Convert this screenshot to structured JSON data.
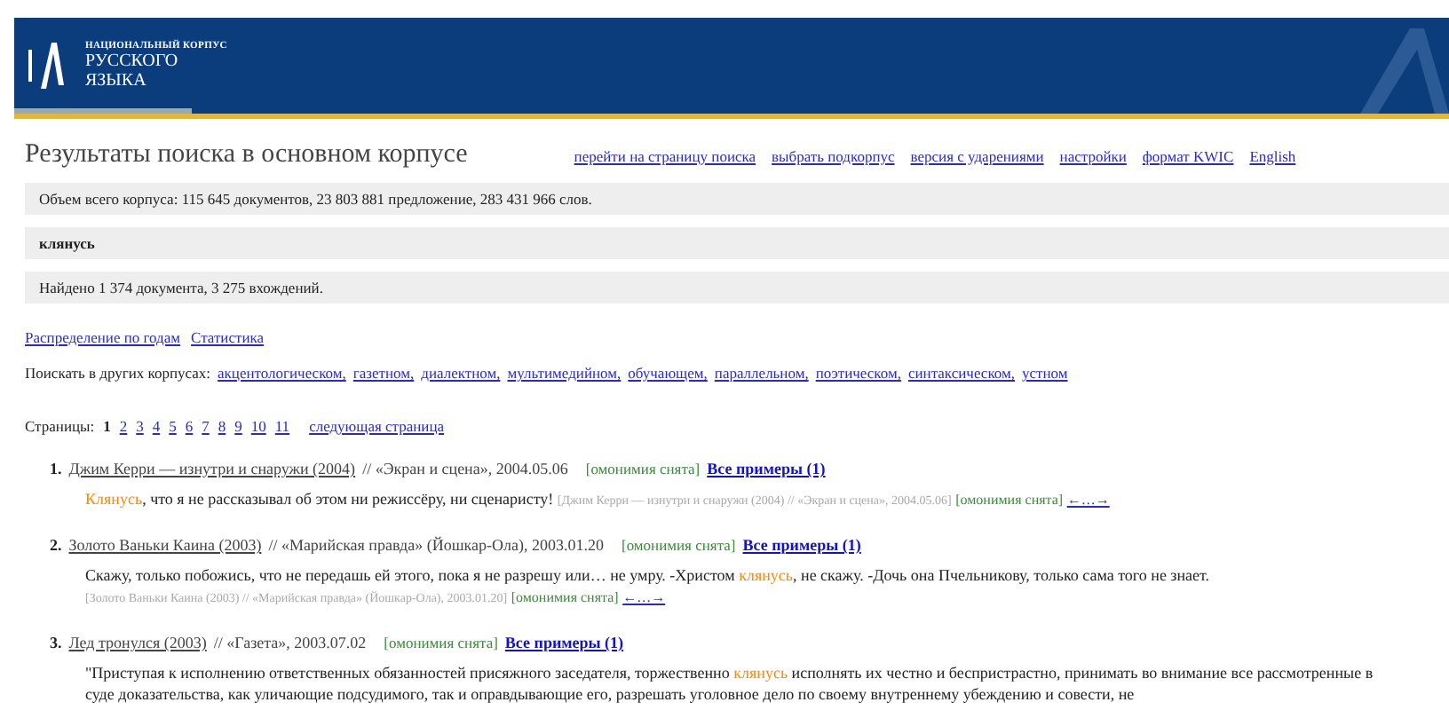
{
  "header": {
    "logo_small": "НАЦИОНАЛЬНЫЙ КОРПУС",
    "logo_line1": "РУССКОГО",
    "logo_line2": "ЯЗЫКА"
  },
  "page_title": "Результаты поиска в основном корпусе",
  "nav_links": [
    "перейти на страницу поиска",
    "выбрать подкорпус",
    "версия с ударениями",
    "настройки",
    "формат KWIC",
    "English"
  ],
  "corpus_size": "Объем всего корпуса: 115 645 документов, 23 803 881 предложение, 283 431 966 слов.",
  "query": "клянусь",
  "found": "Найдено 1 374 документа, 3 275 вхождений.",
  "stats_links": [
    "Распределение по годам",
    "Статистика"
  ],
  "other_corpora": {
    "label": "Поискать в других корпусах:",
    "links": [
      "акцентологическом,",
      "газетном,",
      "диалектном,",
      "мультимедийном,",
      "обучающем,",
      "параллельном,",
      "поэтическом,",
      "синтаксическом,",
      "устном"
    ]
  },
  "pagination": {
    "label": "Страницы:",
    "pages": [
      {
        "text": "1",
        "selected": true
      },
      {
        "text": "2",
        "selected": false
      },
      {
        "text": "3",
        "selected": false
      },
      {
        "text": "4",
        "selected": false
      },
      {
        "text": "5",
        "selected": false
      },
      {
        "text": "6",
        "selected": false
      },
      {
        "text": "7",
        "selected": false
      },
      {
        "text": "8",
        "selected": false
      },
      {
        "text": "9",
        "selected": false
      },
      {
        "text": "10",
        "selected": false
      },
      {
        "text": "11",
        "selected": false
      }
    ],
    "next": "следующая страница"
  },
  "results": [
    {
      "number": "1.",
      "title": "Джим Керри — изнутри и снаружи (2004)",
      "source": "// «Экран и сцена», 2004.05.06",
      "homonymy": "[омонимия снята]",
      "all_examples": "Все примеры (1)",
      "snippet": {
        "parts": [
          {
            "kind": "hit",
            "text": "Клянусь"
          },
          {
            "kind": "plain",
            "text": ", что я не рассказывал об этом ни режиссёру, ни сценаристу!"
          }
        ],
        "ref": "[Джим Керри — изнутри и снаружи (2004) // «Экран и сцена», 2004.05.06]",
        "homonymy": "[омонимия снята]",
        "context_link": "←…→"
      }
    },
    {
      "number": "2.",
      "title": "Золото Ваньки Каина (2003)",
      "source": "// «Марийская правда» (Йошкар-Ола), 2003.01.20",
      "homonymy": "[омонимия снята]",
      "all_examples": "Все примеры (1)",
      "snippet": {
        "parts": [
          {
            "kind": "plain",
            "text": "Скажу, только побожись, что не передашь ей этого, пока я не разрешу или… не умру. -Христом "
          },
          {
            "kind": "hit",
            "text": "клянусь"
          },
          {
            "kind": "plain",
            "text": ", не скажу. -Дочь она Пчельникову, только сама того не знает."
          }
        ],
        "ref": "[Золото Ваньки Каина (2003) // «Марийская правда» (Йошкар-Ола), 2003.01.20]",
        "homonymy": "[омонимия снята]",
        "context_link": "←…→"
      }
    },
    {
      "number": "3.",
      "title": "Лед тронулся (2003)",
      "source": "// «Газета», 2003.07.02",
      "homonymy": "[омонимия снята]",
      "all_examples": "Все примеры (1)",
      "snippet": {
        "parts": [
          {
            "kind": "plain",
            "text": "\"Приступая к исполнению ответственных обязанностей присяжного заседателя, торжественно "
          },
          {
            "kind": "hit",
            "text": "клянусь"
          },
          {
            "kind": "plain",
            "text": " исполнять их честно и беспристрастно, принимать во внимание все рассмотренные в суде доказательства, как уличающие подсудимого, так и оправдывающие его, разрешать уголовное дело по своему внутреннему убеждению и совести, не"
          }
        ]
      }
    }
  ]
}
